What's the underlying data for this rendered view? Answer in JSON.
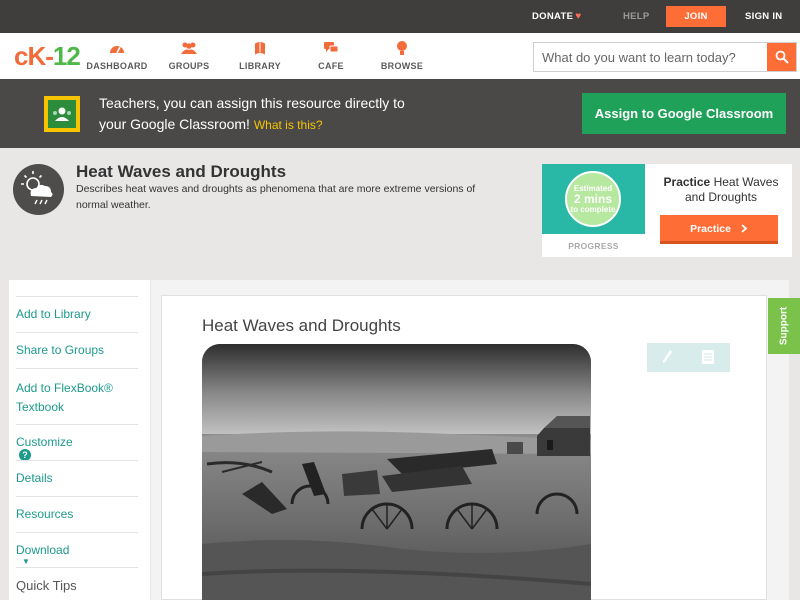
{
  "topbar": {
    "donate": "DONATE",
    "help": "HELP",
    "join": "JOIN",
    "signin": "SIGN IN"
  },
  "header": {
    "logo": {
      "c": "c",
      "k": "K-",
      "n": "12"
    },
    "nav": [
      {
        "label": "DASHBOARD",
        "icon": "dashboard-icon"
      },
      {
        "label": "GROUPS",
        "icon": "groups-icon"
      },
      {
        "label": "LIBRARY",
        "icon": "library-icon"
      },
      {
        "label": "CAFE",
        "icon": "cafe-icon"
      },
      {
        "label": "BROWSE",
        "icon": "browse-icon"
      }
    ],
    "search_placeholder": "What do you want to learn today?"
  },
  "banner": {
    "line1": "Teachers, you can assign this resource directly to",
    "line2": "your Google Classroom!",
    "what": "What is this?",
    "button": "Assign to Google Classroom"
  },
  "concept": {
    "title": "Heat Waves and Droughts",
    "description": "Describes heat waves and droughts as phenomena that are more extreme versions of normal weather."
  },
  "practice": {
    "estimated": "Estimated",
    "mins": "2 mins",
    "to_complete": "to complete",
    "progress_label": "PROGRESS",
    "title_bold": "Practice",
    "title_rest": "Heat Waves and Droughts",
    "button": "Practice"
  },
  "sidebar": {
    "items": [
      {
        "label": "Add to Library"
      },
      {
        "label": "Share to Groups"
      },
      {
        "label": "Add to FlexBook® Textbook"
      },
      {
        "label": "Customize"
      },
      {
        "label": "Details"
      },
      {
        "label": "Resources"
      },
      {
        "label": "Download"
      }
    ],
    "help_glyph": "?",
    "quick_tips": "Quick Tips"
  },
  "main": {
    "title": "Heat Waves and Droughts"
  },
  "support": "Support",
  "colors": {
    "accent": "#ff6d36",
    "teal": "#1d9a8c",
    "green": "#20a15a",
    "support": "#7bc24a"
  }
}
